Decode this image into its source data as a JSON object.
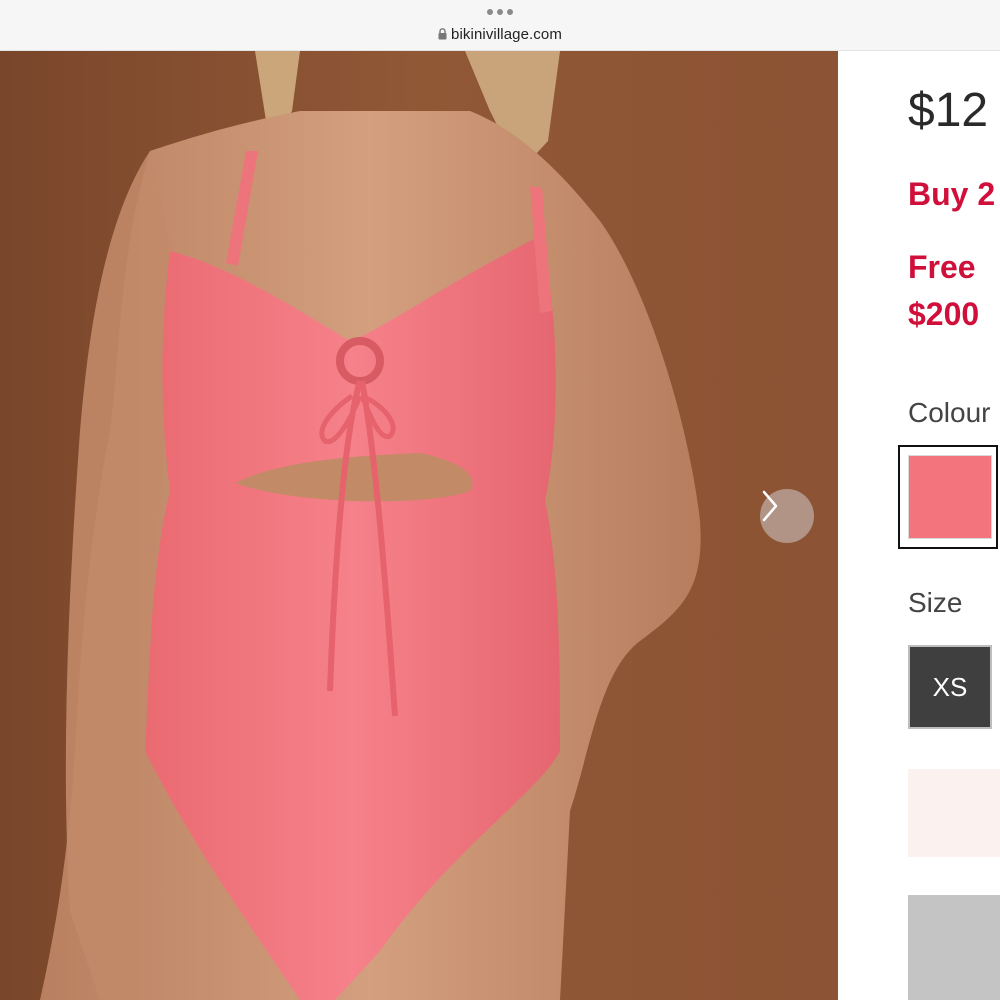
{
  "browser": {
    "url": "bikinivillage.com"
  },
  "product": {
    "price": "$12",
    "promos": [
      "Buy 2",
      "Free",
      "$200"
    ],
    "colour_label": "Colour",
    "size_label": "Size",
    "sizes": [
      "XS"
    ],
    "selected_colour_hex": "#f4747e",
    "accent_color": "#d0103a"
  },
  "icons": {
    "next": "chevron-right-icon",
    "lock": "lock-icon",
    "menu": "more-dots-icon"
  }
}
